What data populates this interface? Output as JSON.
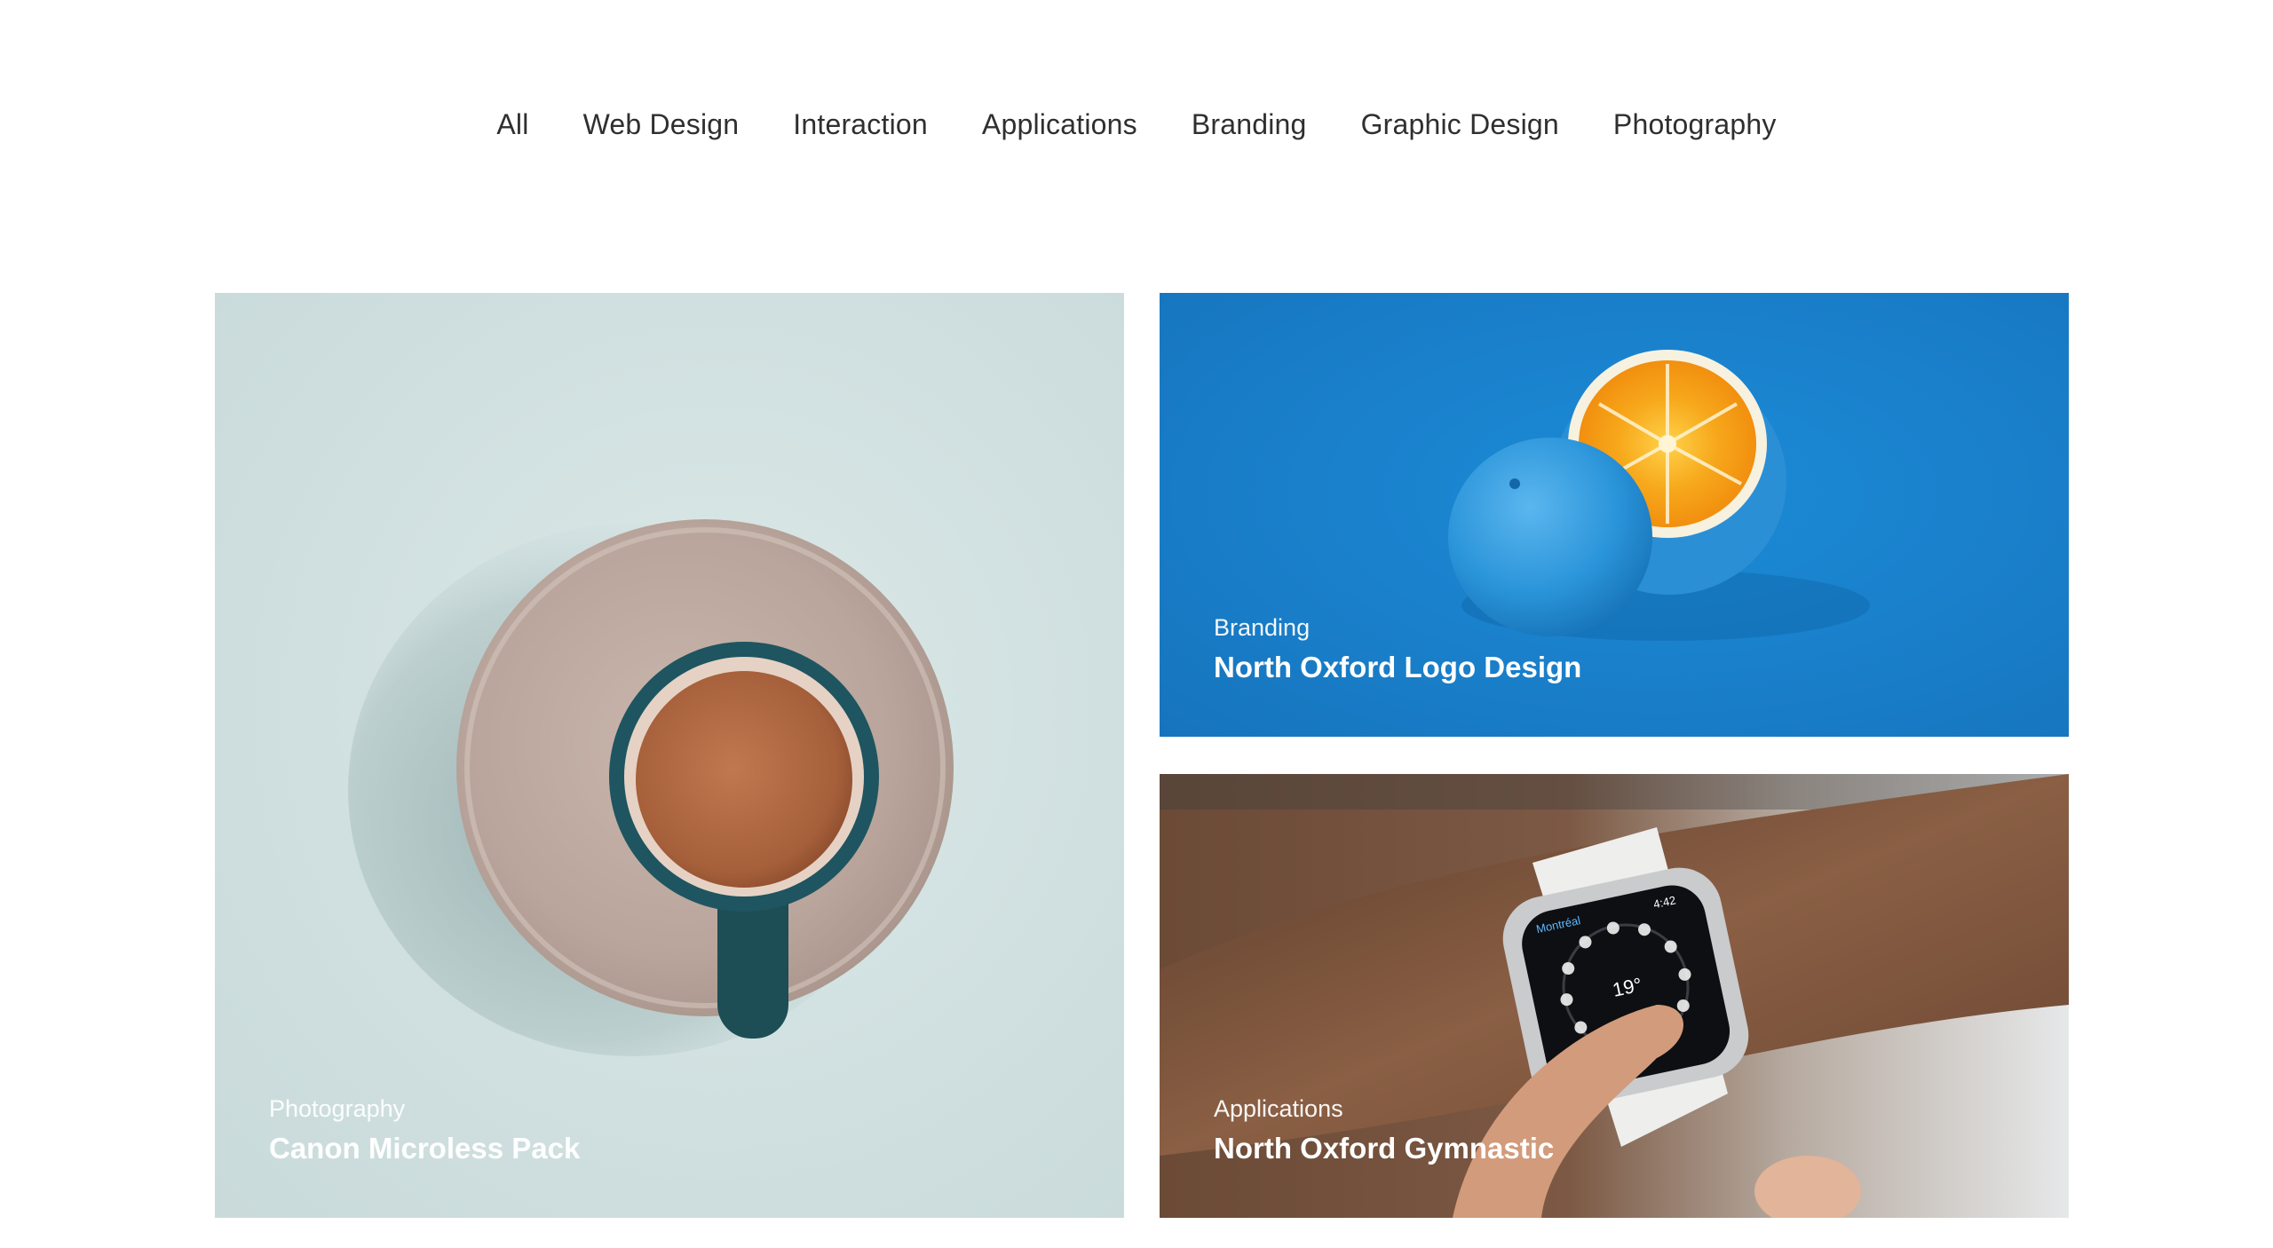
{
  "filters": [
    {
      "label": "All"
    },
    {
      "label": "Web Design"
    },
    {
      "label": "Interaction"
    },
    {
      "label": "Applications"
    },
    {
      "label": "Branding"
    },
    {
      "label": "Graphic Design"
    },
    {
      "label": "Photography"
    }
  ],
  "portfolio": {
    "items": [
      {
        "category": "Photography",
        "title": "Canon Microless Pack",
        "image": "coffee-cup-photo"
      },
      {
        "category": "Branding",
        "title": "North Oxford Logo Design",
        "image": "blue-orange-photo"
      },
      {
        "category": "Applications",
        "title": "North Oxford Gymnastic",
        "image": "smartwatch-photo"
      }
    ]
  },
  "watch": {
    "city": "Montréal",
    "time": "4:42",
    "temp": "19°"
  },
  "colors": {
    "text": "#2f2f2f",
    "caption": "#ffffff",
    "coffee_bg": "#d2e1e1",
    "orange_bg": "#1a80cb"
  }
}
